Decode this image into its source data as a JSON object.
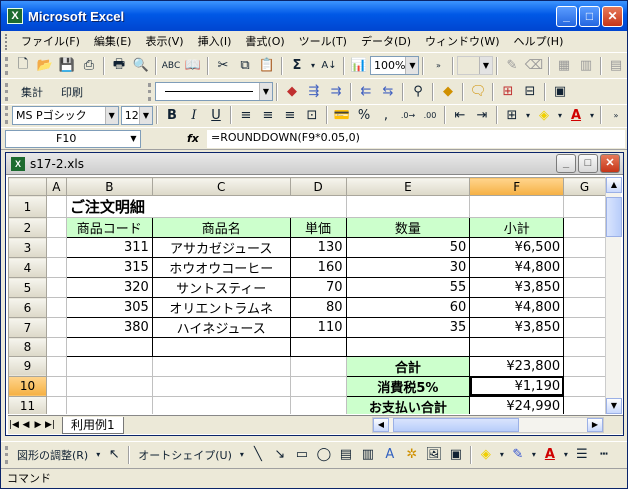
{
  "window": {
    "title": "Microsoft Excel",
    "app_icon": "X"
  },
  "menu": [
    "ファイル(F)",
    "編集(E)",
    "表示(V)",
    "挿入(I)",
    "書式(O)",
    "ツール(T)",
    "データ(D)",
    "ウィンドウ(W)",
    "ヘルプ(H)"
  ],
  "toolbar1": {
    "zoom": "100%"
  },
  "toolbar2": {
    "btn_shukei": "集計",
    "btn_insatsu": "印刷"
  },
  "toolbar3": {
    "font": "MS Pゴシック",
    "size": "12",
    "bold": "B",
    "italic": "I",
    "underline": "U",
    "percent": "%",
    "comma": ",",
    "font_color_letter": "A"
  },
  "formula_bar": {
    "cell_ref": "F10",
    "fx": "fx",
    "formula": "=ROUNDDOWN(F9*0.05,0)"
  },
  "document": {
    "title": "s17-2.xls",
    "icon": "X"
  },
  "columns": [
    "",
    "A",
    "B",
    "C",
    "D",
    "E",
    "F",
    "G"
  ],
  "rows": {
    "r1": {
      "num": "1",
      "title": "ご注文明細"
    },
    "r2": {
      "num": "2",
      "h1": "商品コード",
      "h2": "商品名",
      "h3": "単価",
      "h4": "数量",
      "h5": "小計"
    },
    "r3": {
      "num": "3",
      "code": "311",
      "name": "アサカゼジュース",
      "price": "130",
      "qty": "50",
      "sub": "¥6,500"
    },
    "r4": {
      "num": "4",
      "code": "315",
      "name": "ホウオウコーヒー",
      "price": "160",
      "qty": "30",
      "sub": "¥4,800"
    },
    "r5": {
      "num": "5",
      "code": "320",
      "name": "サントスティー",
      "price": "70",
      "qty": "55",
      "sub": "¥3,850"
    },
    "r6": {
      "num": "6",
      "code": "305",
      "name": "オリエントラムネ",
      "price": "80",
      "qty": "60",
      "sub": "¥4,800"
    },
    "r7": {
      "num": "7",
      "code": "380",
      "name": "ハイネジュース",
      "price": "110",
      "qty": "35",
      "sub": "¥3,850"
    },
    "r8": {
      "num": "8"
    },
    "r9": {
      "num": "9",
      "label": "合計",
      "value": "¥23,800"
    },
    "r10": {
      "num": "10",
      "label": "消費税5%",
      "value": "¥1,190"
    },
    "r11": {
      "num": "11",
      "label": "お支払い合計",
      "value": "¥24,990"
    }
  },
  "sheet_tab": "利用例1",
  "drawbar": {
    "zukei": "図形の調整(R)",
    "autoshape": "オートシェイプ(U)",
    "font_color_letter": "A"
  },
  "status": "コマンド",
  "colors": {
    "header_green": "#ccffcc",
    "selected_header": "#f5b043",
    "title_blue": "#0058e6"
  }
}
